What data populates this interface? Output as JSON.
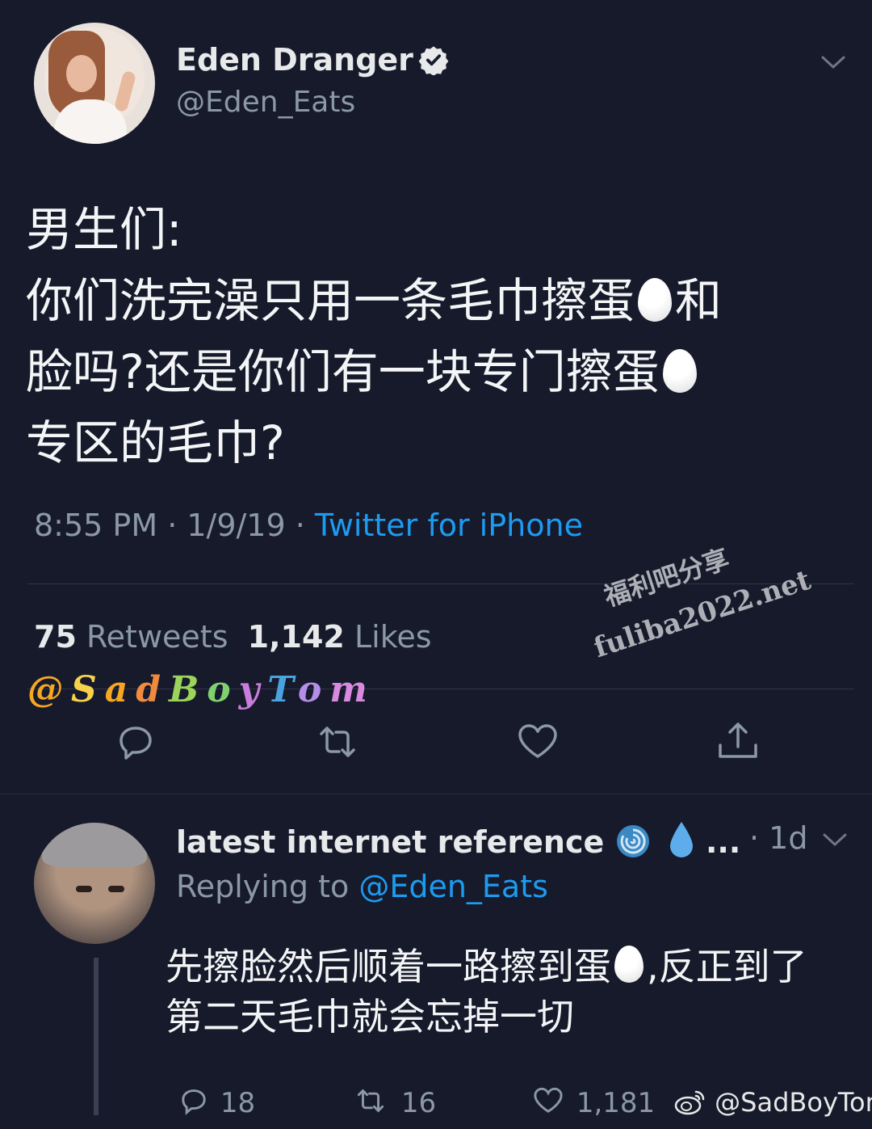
{
  "tweet": {
    "author_name": "Eden Dranger",
    "author_handle": "@Eden_Eats",
    "text_line1": "男生们:",
    "text_line2a": "你们洗完澡只用一条毛巾擦蛋",
    "text_line2b": "和",
    "text_line3a": "脸吗?还是你们有一块专门擦蛋",
    "text_line4": "专区的毛巾?",
    "time": "8:55 PM · 1/9/19 · ",
    "source": "Twitter for iPhone",
    "retweets_count": "75",
    "retweets_label": "Retweets",
    "likes_count": "1,142",
    "likes_label": "Likes",
    "egg_icon": "egg-emoji"
  },
  "overlays": {
    "signature": "@SadBoyTom",
    "watermark_line1": "福利吧分享",
    "watermark_line2": "fuliba2022.net",
    "weibo_credit": "@SadBoyTom"
  },
  "reply": {
    "author_name": "latest internet reference",
    "ellipsis": "...",
    "time": "· 1d",
    "replying_prefix": "Replying to ",
    "replying_handle": "@Eden_Eats",
    "text_a": "先擦脸然后顺着一路擦到蛋",
    "text_b": ",反正到了第二天毛巾就会忘掉一切",
    "reply_count": "18",
    "retweet_count": "16",
    "like_count": "1,181"
  },
  "colors": {
    "background": "#161a2b",
    "link_blue": "#1d9bf0",
    "muted": "#8b98a5"
  }
}
